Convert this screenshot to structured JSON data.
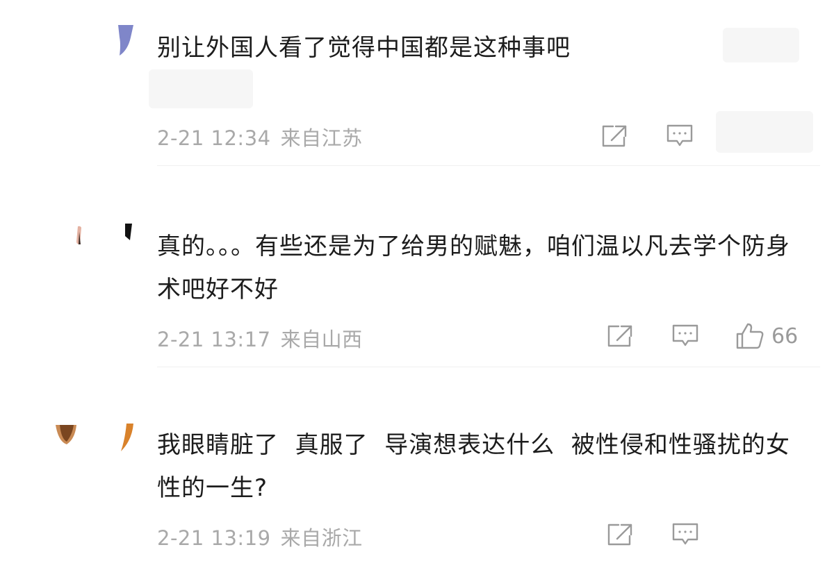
{
  "comments": [
    {
      "text": "别让外国人看了觉得中国都是这种事吧",
      "date": "2-21 12:34",
      "location": "来自江苏",
      "share_icon": "share-icon",
      "reply_icon": "comment-icon"
    },
    {
      "text": "真的。。。有些还是为了给男的赋魅，咱们温以凡去学个防身术吧好不好",
      "date": "2-21 13:17",
      "location": "来自山西",
      "share_icon": "share-icon",
      "reply_icon": "comment-icon",
      "like_icon": "thumbs-up-icon",
      "likes": "66"
    },
    {
      "text": "我眼睛脏了  真服了  导演想表达什么  被性侵和性骚扰的女性的一生?",
      "date": "2-21 13:19",
      "location": "来自浙江",
      "share_icon": "share-icon",
      "reply_icon": "comment-icon"
    }
  ],
  "colors": {
    "text": "#1c1c1c",
    "meta": "#a9a9a9",
    "icon": "#9a9a9a"
  }
}
